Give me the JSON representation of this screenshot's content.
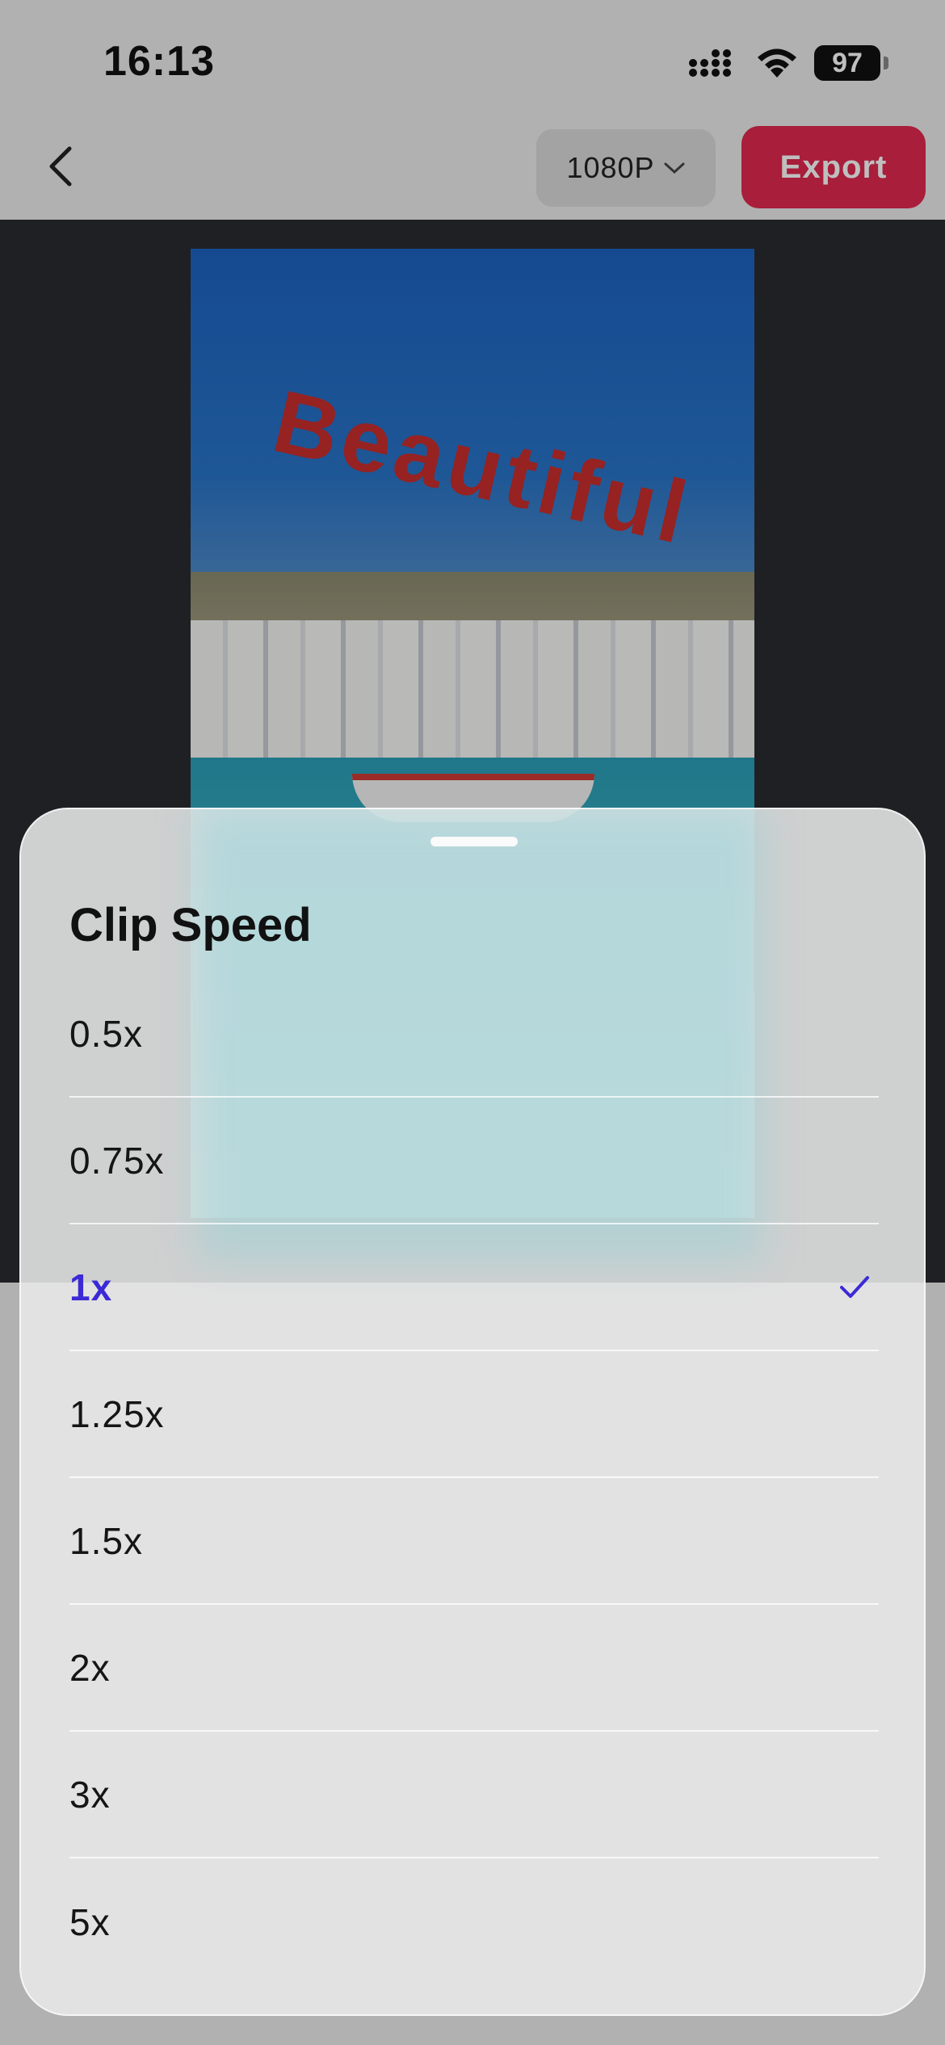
{
  "status_bar": {
    "time": "16:13",
    "battery": "97"
  },
  "header": {
    "resolution": "1080P",
    "export_label": "Export"
  },
  "preview": {
    "overlay_text": "Beautiful"
  },
  "sheet": {
    "title": "Clip Speed",
    "options": [
      "0.5x",
      "0.75x",
      "1x",
      "1.25x",
      "1.5x",
      "2x",
      "3x",
      "5x"
    ],
    "selected": "1x"
  },
  "colors": {
    "export": "#e0294f",
    "selected": "#3b2ad6"
  }
}
